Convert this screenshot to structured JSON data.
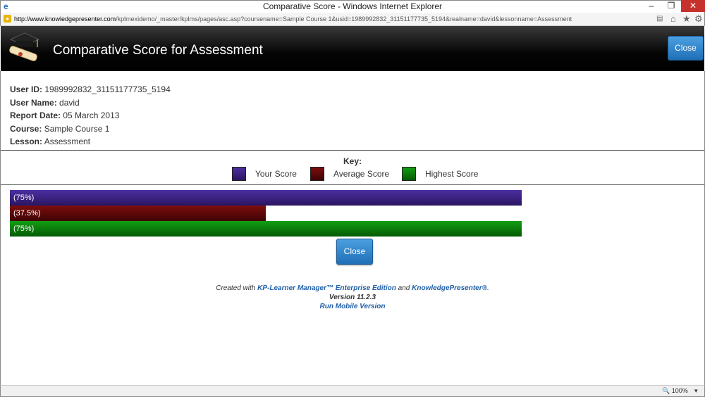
{
  "window": {
    "title": "Comparative Score - Windows Internet Explorer",
    "url_host": "http://www.knowledgepresenter.com",
    "url_rest": "/kplmexidemo/_master/kplms/pages/asc.asp?coursename=Sample Course 1&usid=1989992832_31151177735_5194&realname=david&lessonname=Assessment",
    "zoom": "100%"
  },
  "header": {
    "title": "Comparative Score for Assessment",
    "close_label": "Close"
  },
  "info": {
    "user_id_label": "User ID:",
    "user_id": "1989992832_31151177735_5194",
    "user_name_label": "User Name:",
    "user_name": "david",
    "report_date_label": "Report Date:",
    "report_date": "05 March 2013",
    "course_label": "Course:",
    "course": "Sample Course 1",
    "lesson_label": "Lesson:",
    "lesson": "Assessment"
  },
  "key": {
    "title": "Key:",
    "your": "Your Score",
    "average": "Average Score",
    "highest": "Highest Score"
  },
  "colors": {
    "your": "#3b2288",
    "average": "#5e0808",
    "highest": "#0a8a0a",
    "button": "#2a7fc8"
  },
  "bars": {
    "your": {
      "label": "(75%)",
      "percent": 75
    },
    "average": {
      "label": "(37.5%)",
      "percent": 37.5
    },
    "highest": {
      "label": "(75%)",
      "percent": 75
    }
  },
  "close_button": "Close",
  "footer": {
    "created_with": "Created with",
    "product": "KP-Learner Manager™ Enterprise Edition",
    "and": "and",
    "product2": "KnowledgePresenter®",
    "period": ".",
    "version": "Version 11.2.3",
    "mobile": "Run Mobile Version"
  }
}
